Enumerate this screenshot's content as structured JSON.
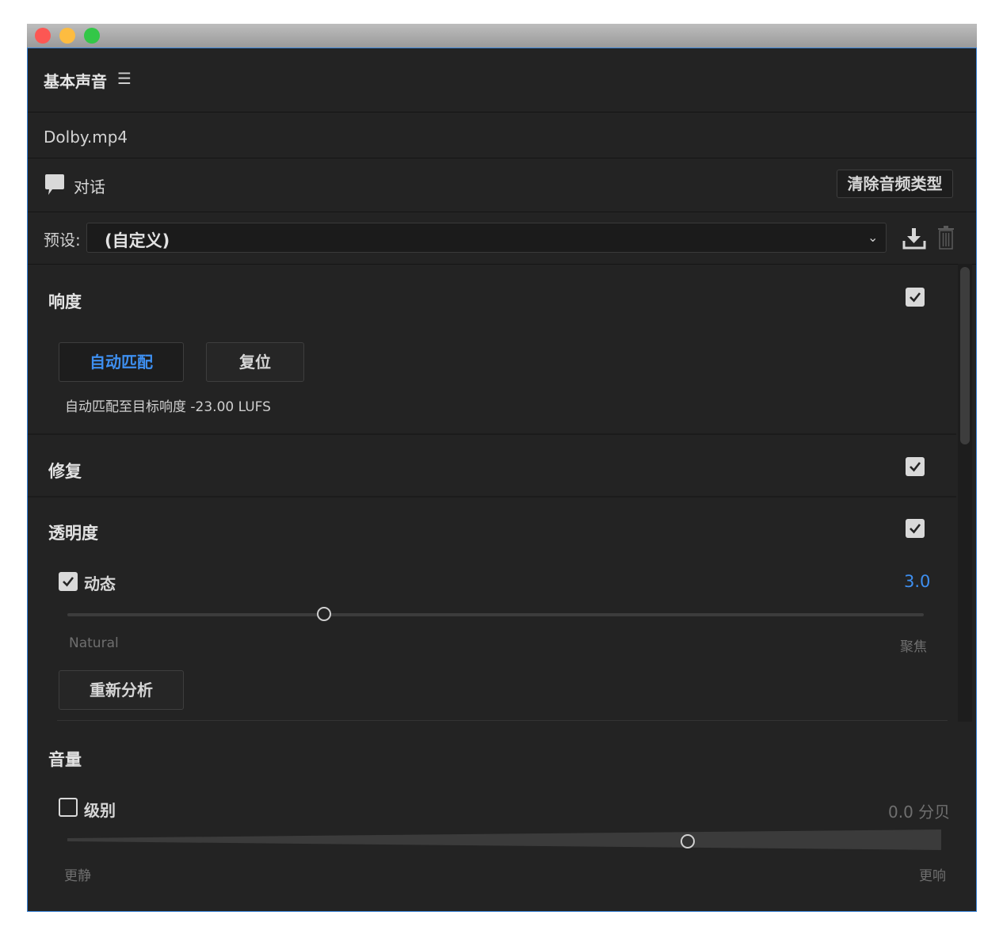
{
  "header": {
    "title": "基本声音",
    "menu_icon": "hamburger-icon"
  },
  "file": {
    "name": "Dolby.mp4"
  },
  "audio_type": {
    "icon": "speech-bubble-icon",
    "label": "对话",
    "clear_button": "清除音频类型"
  },
  "preset": {
    "label": "预设:",
    "value": "(自定义)",
    "save_icon": "download-icon",
    "delete_icon": "trash-icon"
  },
  "loudness": {
    "title": "响度",
    "enabled": true,
    "auto_match_button": "自动匹配",
    "reset_button": "复位",
    "info": "自动匹配至目标响度 -23.00 LUFS"
  },
  "repair": {
    "title": "修复",
    "enabled": true
  },
  "clarity": {
    "title": "透明度",
    "enabled": true,
    "dynamics": {
      "label": "动态",
      "checked": true,
      "value": "3.0",
      "slider_fraction": 0.3,
      "min_label": "Natural",
      "max_label": "聚焦"
    },
    "reanalyze_button": "重新分析"
  },
  "volume": {
    "title": "音量",
    "level": {
      "label": "级别",
      "checked": false,
      "value": "0.0 分贝",
      "slider_fraction": 0.71,
      "min_label": "更静",
      "max_label": "更响"
    }
  },
  "colors": {
    "accent": "#3e8ff0",
    "panel_border": "#3b84d8",
    "background": "#232323"
  }
}
